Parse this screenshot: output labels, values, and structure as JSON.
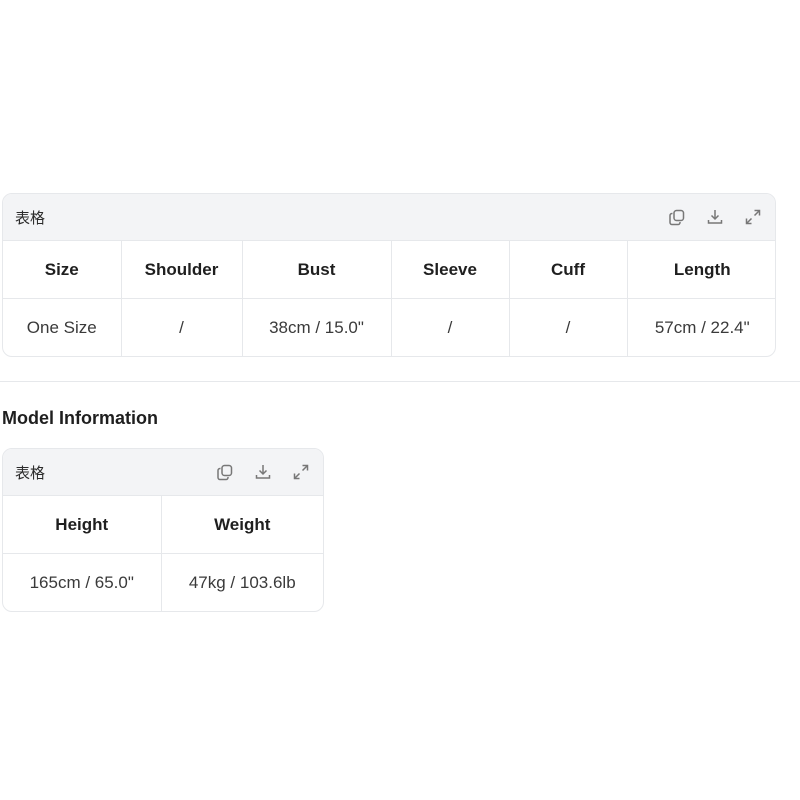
{
  "size_table": {
    "label": "表格",
    "headers": [
      "Size",
      "Shoulder",
      "Bust",
      "Sleeve",
      "Cuff",
      "Length"
    ],
    "rows": [
      [
        "One Size",
        "/",
        "38cm / 15.0\"",
        "/",
        "/",
        "57cm / 22.4\""
      ]
    ],
    "icons": [
      "copy-icon",
      "download-icon",
      "expand-icon"
    ]
  },
  "model_section": {
    "heading": "Model Information"
  },
  "model_table": {
    "label": "表格",
    "headers": [
      "Height",
      "Weight"
    ],
    "rows": [
      [
        "165cm / 65.0\"",
        "47kg / 103.6lb"
      ]
    ],
    "icons": [
      "copy-icon",
      "download-icon",
      "expand-icon"
    ]
  }
}
